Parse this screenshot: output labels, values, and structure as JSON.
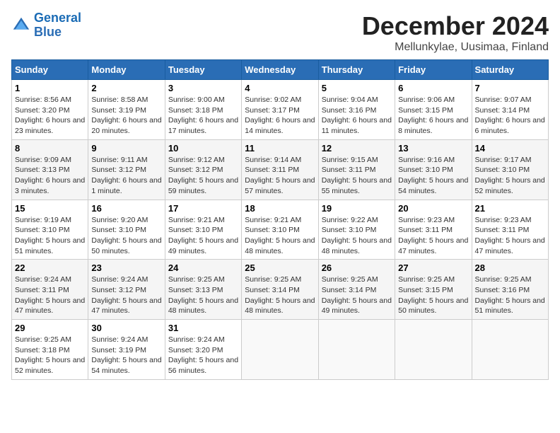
{
  "header": {
    "logo_line1": "General",
    "logo_line2": "Blue",
    "title": "December 2024",
    "subtitle": "Mellunkylae, Uusimaa, Finland"
  },
  "days_of_week": [
    "Sunday",
    "Monday",
    "Tuesday",
    "Wednesday",
    "Thursday",
    "Friday",
    "Saturday"
  ],
  "weeks": [
    [
      {
        "day": "1",
        "sunrise": "8:56 AM",
        "sunset": "3:20 PM",
        "daylight": "6 hours and 23 minutes."
      },
      {
        "day": "2",
        "sunrise": "8:58 AM",
        "sunset": "3:19 PM",
        "daylight": "6 hours and 20 minutes."
      },
      {
        "day": "3",
        "sunrise": "9:00 AM",
        "sunset": "3:18 PM",
        "daylight": "6 hours and 17 minutes."
      },
      {
        "day": "4",
        "sunrise": "9:02 AM",
        "sunset": "3:17 PM",
        "daylight": "6 hours and 14 minutes."
      },
      {
        "day": "5",
        "sunrise": "9:04 AM",
        "sunset": "3:16 PM",
        "daylight": "6 hours and 11 minutes."
      },
      {
        "day": "6",
        "sunrise": "9:06 AM",
        "sunset": "3:15 PM",
        "daylight": "6 hours and 8 minutes."
      },
      {
        "day": "7",
        "sunrise": "9:07 AM",
        "sunset": "3:14 PM",
        "daylight": "6 hours and 6 minutes."
      }
    ],
    [
      {
        "day": "8",
        "sunrise": "9:09 AM",
        "sunset": "3:13 PM",
        "daylight": "6 hours and 3 minutes."
      },
      {
        "day": "9",
        "sunrise": "9:11 AM",
        "sunset": "3:12 PM",
        "daylight": "6 hours and 1 minute."
      },
      {
        "day": "10",
        "sunrise": "9:12 AM",
        "sunset": "3:12 PM",
        "daylight": "5 hours and 59 minutes."
      },
      {
        "day": "11",
        "sunrise": "9:14 AM",
        "sunset": "3:11 PM",
        "daylight": "5 hours and 57 minutes."
      },
      {
        "day": "12",
        "sunrise": "9:15 AM",
        "sunset": "3:11 PM",
        "daylight": "5 hours and 55 minutes."
      },
      {
        "day": "13",
        "sunrise": "9:16 AM",
        "sunset": "3:10 PM",
        "daylight": "5 hours and 54 minutes."
      },
      {
        "day": "14",
        "sunrise": "9:17 AM",
        "sunset": "3:10 PM",
        "daylight": "5 hours and 52 minutes."
      }
    ],
    [
      {
        "day": "15",
        "sunrise": "9:19 AM",
        "sunset": "3:10 PM",
        "daylight": "5 hours and 51 minutes."
      },
      {
        "day": "16",
        "sunrise": "9:20 AM",
        "sunset": "3:10 PM",
        "daylight": "5 hours and 50 minutes."
      },
      {
        "day": "17",
        "sunrise": "9:21 AM",
        "sunset": "3:10 PM",
        "daylight": "5 hours and 49 minutes."
      },
      {
        "day": "18",
        "sunrise": "9:21 AM",
        "sunset": "3:10 PM",
        "daylight": "5 hours and 48 minutes."
      },
      {
        "day": "19",
        "sunrise": "9:22 AM",
        "sunset": "3:10 PM",
        "daylight": "5 hours and 48 minutes."
      },
      {
        "day": "20",
        "sunrise": "9:23 AM",
        "sunset": "3:11 PM",
        "daylight": "5 hours and 47 minutes."
      },
      {
        "day": "21",
        "sunrise": "9:23 AM",
        "sunset": "3:11 PM",
        "daylight": "5 hours and 47 minutes."
      }
    ],
    [
      {
        "day": "22",
        "sunrise": "9:24 AM",
        "sunset": "3:11 PM",
        "daylight": "5 hours and 47 minutes."
      },
      {
        "day": "23",
        "sunrise": "9:24 AM",
        "sunset": "3:12 PM",
        "daylight": "5 hours and 47 minutes."
      },
      {
        "day": "24",
        "sunrise": "9:25 AM",
        "sunset": "3:13 PM",
        "daylight": "5 hours and 48 minutes."
      },
      {
        "day": "25",
        "sunrise": "9:25 AM",
        "sunset": "3:14 PM",
        "daylight": "5 hours and 48 minutes."
      },
      {
        "day": "26",
        "sunrise": "9:25 AM",
        "sunset": "3:14 PM",
        "daylight": "5 hours and 49 minutes."
      },
      {
        "day": "27",
        "sunrise": "9:25 AM",
        "sunset": "3:15 PM",
        "daylight": "5 hours and 50 minutes."
      },
      {
        "day": "28",
        "sunrise": "9:25 AM",
        "sunset": "3:16 PM",
        "daylight": "5 hours and 51 minutes."
      }
    ],
    [
      {
        "day": "29",
        "sunrise": "9:25 AM",
        "sunset": "3:18 PM",
        "daylight": "5 hours and 52 minutes."
      },
      {
        "day": "30",
        "sunrise": "9:24 AM",
        "sunset": "3:19 PM",
        "daylight": "5 hours and 54 minutes."
      },
      {
        "day": "31",
        "sunrise": "9:24 AM",
        "sunset": "3:20 PM",
        "daylight": "5 hours and 56 minutes."
      },
      null,
      null,
      null,
      null
    ]
  ]
}
